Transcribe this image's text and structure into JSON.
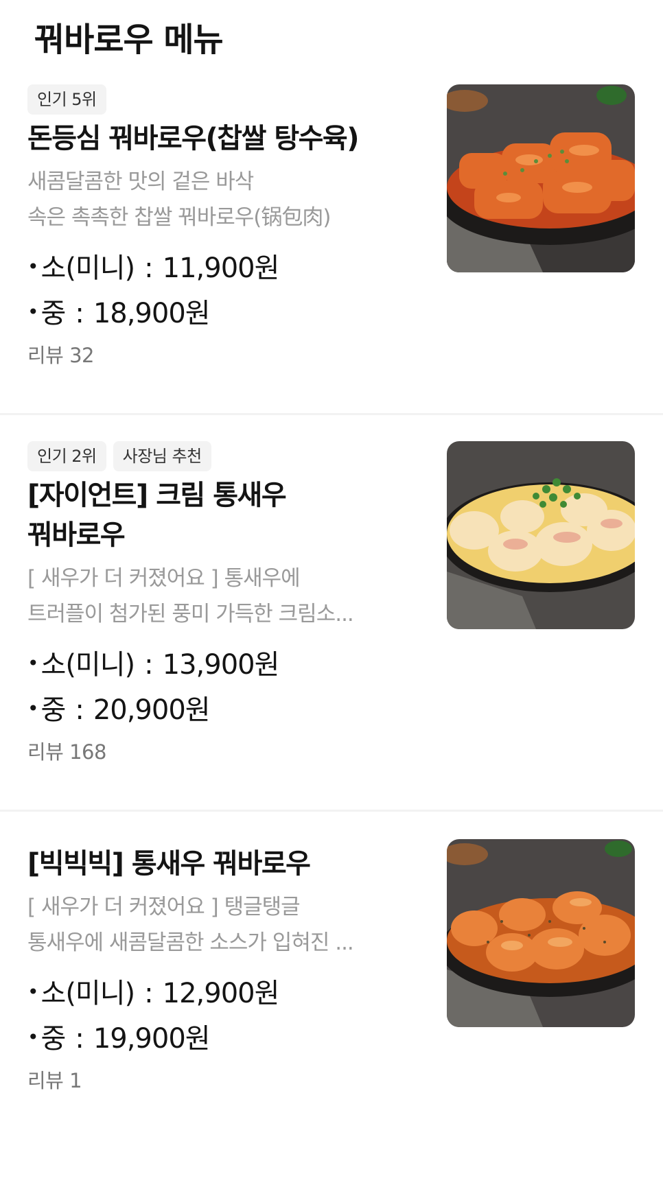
{
  "section": {
    "title": "꿔바로우 메뉴"
  },
  "items": [
    {
      "badges": [
        "인기 5위"
      ],
      "name_lines": [
        "돈등심 꿔바로우(찹쌀 탕수육)"
      ],
      "desc_lines": [
        "새콤달콤한 맛의 겉은 바삭",
        "속은 촉촉한 찹쌀 꿔바로우(锅包肉)"
      ],
      "prices": [
        {
          "bullet": "•",
          "size": "소(미니)",
          "sep": ":",
          "price": "11,900원"
        },
        {
          "bullet": "•",
          "size": "중",
          "sep": ":",
          "price": "18,900원"
        }
      ],
      "reviews": "리뷰 32",
      "photo": {
        "icon": "sweet-sour-pork-photo",
        "sauce_color": "#d9531f"
      }
    },
    {
      "badges": [
        "인기 2위",
        "사장님 추천"
      ],
      "name_lines": [
        "[자이언트] 크림 통새우",
        "꿔바로우"
      ],
      "desc_lines": [
        "[ 새우가 더 커졌어요 ] 통새우에",
        "트러플이 첨가된 풍미 가득한 크림소..."
      ],
      "prices": [
        {
          "bullet": "•",
          "size": "소(미니)",
          "sep": ":",
          "price": "13,900원"
        },
        {
          "bullet": "•",
          "size": "중",
          "sep": ":",
          "price": "20,900원"
        }
      ],
      "reviews": "리뷰 168",
      "photo": {
        "icon": "cream-shrimp-photo",
        "sauce_color": "#f2d27a"
      }
    },
    {
      "badges": [],
      "name_lines": [
        "[빅빅빅] 통새우 꿔바로우"
      ],
      "desc_lines": [
        "[ 새우가 더 커졌어요 ] 탱글탱글",
        "통새우에 새콤달콤한 소스가 입혀진 ..."
      ],
      "prices": [
        {
          "bullet": "•",
          "size": "소(미니)",
          "sep": ":",
          "price": "12,900원"
        },
        {
          "bullet": "•",
          "size": "중",
          "sep": ":",
          "price": "19,900원"
        }
      ],
      "reviews": "리뷰 1",
      "photo": {
        "icon": "big-shrimp-photo",
        "sauce_color": "#e8772a"
      }
    }
  ]
}
